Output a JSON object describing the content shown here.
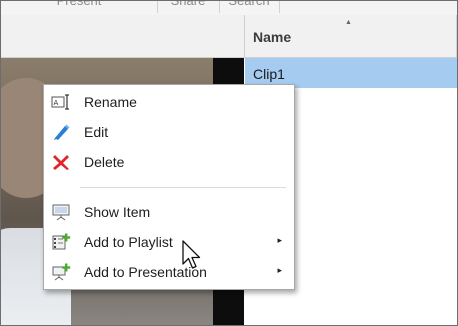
{
  "tabs": [
    "Present",
    "Share",
    "Search"
  ],
  "list": {
    "column_header": "Name",
    "sort_indicator": "▲",
    "rows": [
      "Clip1"
    ]
  },
  "context_menu": {
    "items": [
      {
        "label": "Rename",
        "icon": "rename-icon"
      },
      {
        "label": "Edit",
        "icon": "pencil-icon"
      },
      {
        "label": "Delete",
        "icon": "delete-x-icon"
      },
      {
        "label": "Show Item",
        "icon": "show-item-icon"
      },
      {
        "label": "Add to Playlist",
        "icon": "add-to-playlist-icon",
        "submenu": "▸"
      },
      {
        "label": "Add to Presentation",
        "icon": "add-to-presentation-icon",
        "submenu": "▸"
      }
    ]
  },
  "colors": {
    "selection": "#a6cbf0",
    "delete_red": "#e0262b",
    "edit_blue": "#2a7fd4",
    "add_green": "#4caa2f"
  }
}
